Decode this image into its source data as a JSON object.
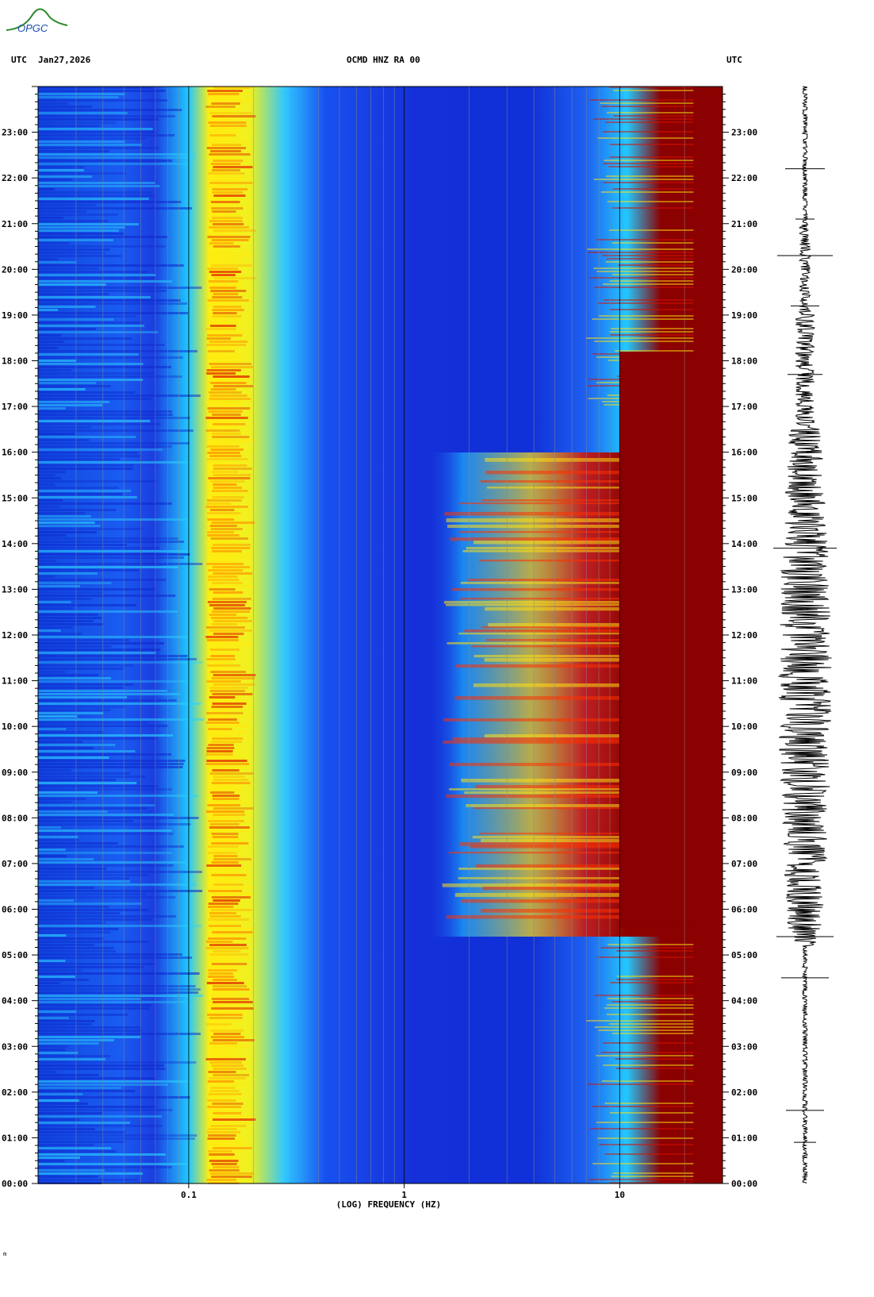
{
  "header": {
    "utc_left": "UTC",
    "date": "Jan27,2026",
    "station": "OCMD HNZ RA 00",
    "utc_right": "UTC",
    "logo_text": "OPGC"
  },
  "footer": {
    "xlabel": "(LOG) FREQUENCY (HZ)",
    "corner_mark": "m"
  },
  "colors": {
    "cold": "#0a1fd8",
    "background_blue": "#1540e8",
    "cyan": "#1ae0ff",
    "yellow": "#ffef10",
    "orange": "#ff7a00",
    "red": "#d81000",
    "hot": "#8b0000"
  },
  "chart_data": {
    "type": "heatmap",
    "title": "OCMD HNZ RA 00",
    "xlabel": "(LOG) FREQUENCY (HZ)",
    "x_scale": "log",
    "xlim": [
      0.02,
      30
    ],
    "x_ticks": [
      {
        "value": 0.1,
        "label": "0.1"
      },
      {
        "value": 1,
        "label": "1"
      },
      {
        "value": 10,
        "label": "10"
      }
    ],
    "ylim_hours": [
      0,
      24
    ],
    "y_ticks": [
      "00:00",
      "01:00",
      "02:00",
      "03:00",
      "04:00",
      "05:00",
      "06:00",
      "07:00",
      "08:00",
      "09:00",
      "10:00",
      "11:00",
      "12:00",
      "13:00",
      "14:00",
      "15:00",
      "16:00",
      "17:00",
      "18:00",
      "19:00",
      "20:00",
      "21:00",
      "22:00",
      "23:00"
    ],
    "microseism_band_hz": [
      0.12,
      0.2
    ],
    "active_band_hours": [
      5.4,
      16.0
    ],
    "high_freq_saturation_hz": 10,
    "colormap": [
      "#0a1fd8",
      "#1540e8",
      "#1ae0ff",
      "#ffef10",
      "#ff7a00",
      "#d81000",
      "#8b0000"
    ],
    "seismogram": "waveform trace 00:00 to 24:00, larger amplitude 05:00-16:00"
  }
}
